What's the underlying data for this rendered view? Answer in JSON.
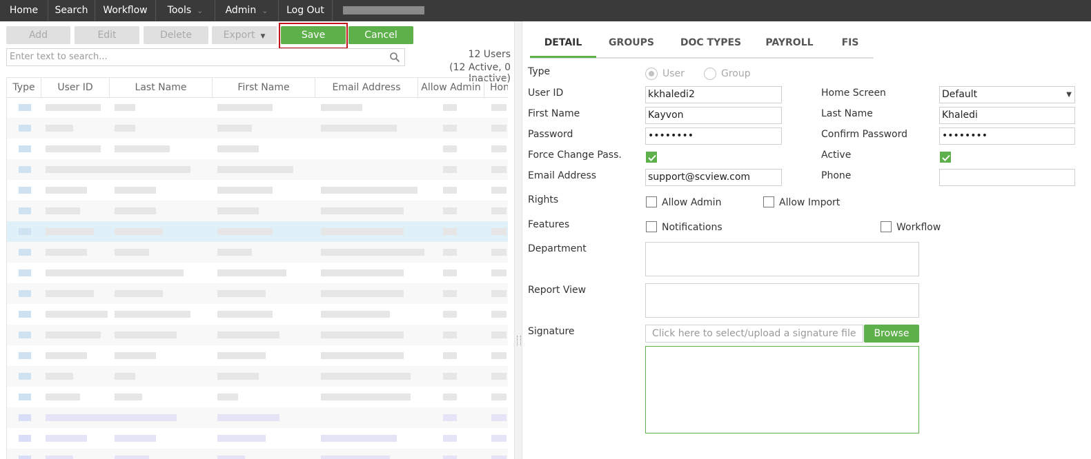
{
  "nav": {
    "home": "Home",
    "search": "Search",
    "workflow": "Workflow",
    "tools": "Tools",
    "admin": "Admin",
    "logout": "Log Out"
  },
  "toolbar": {
    "add": "Add",
    "edit": "Edit",
    "delete": "Delete",
    "export": "Export",
    "save": "Save",
    "cancel": "Cancel"
  },
  "search": {
    "placeholder": "Enter text to search..."
  },
  "users_summary": {
    "count": "12 Users",
    "breakdown": "(12 Active, 0 Inactive)"
  },
  "grid": {
    "columns": [
      "Type",
      "User ID",
      "Last Name",
      "First Name",
      "Email Address",
      "Allow Admin",
      "Hon"
    ]
  },
  "tabs": [
    "DETAIL",
    "GROUPS",
    "DOC TYPES",
    "PAYROLL",
    "FIS"
  ],
  "form": {
    "type_label": "Type",
    "type_user": "User",
    "type_group": "Group",
    "user_id_label": "User ID",
    "user_id_value": "kkhaledi2",
    "home_screen_label": "Home Screen",
    "home_screen_value": "Default",
    "first_name_label": "First Name",
    "first_name_value": "Kayvon",
    "last_name_label": "Last Name",
    "last_name_value": "Khaledi",
    "password_label": "Password",
    "password_value": "••••••••",
    "confirm_password_label": "Confirm Password",
    "confirm_password_value": "••••••••",
    "force_change_label": "Force Change Pass.",
    "active_label": "Active",
    "email_label": "Email Address",
    "email_value": "support@scview.com",
    "phone_label": "Phone",
    "rights_label": "Rights",
    "allow_admin": "Allow Admin",
    "allow_import": "Allow Import",
    "features_label": "Features",
    "notifications": "Notifications",
    "workflow": "Workflow",
    "department_label": "Department",
    "report_view_label": "Report View",
    "signature_label": "Signature",
    "signature_placeholder": "Click here to select/upload a signature file",
    "browse": "Browse"
  },
  "colors": {
    "accent_green": "#5eb04a",
    "nav_bg": "#3a3a3a",
    "highlight_red": "#c0141a"
  }
}
